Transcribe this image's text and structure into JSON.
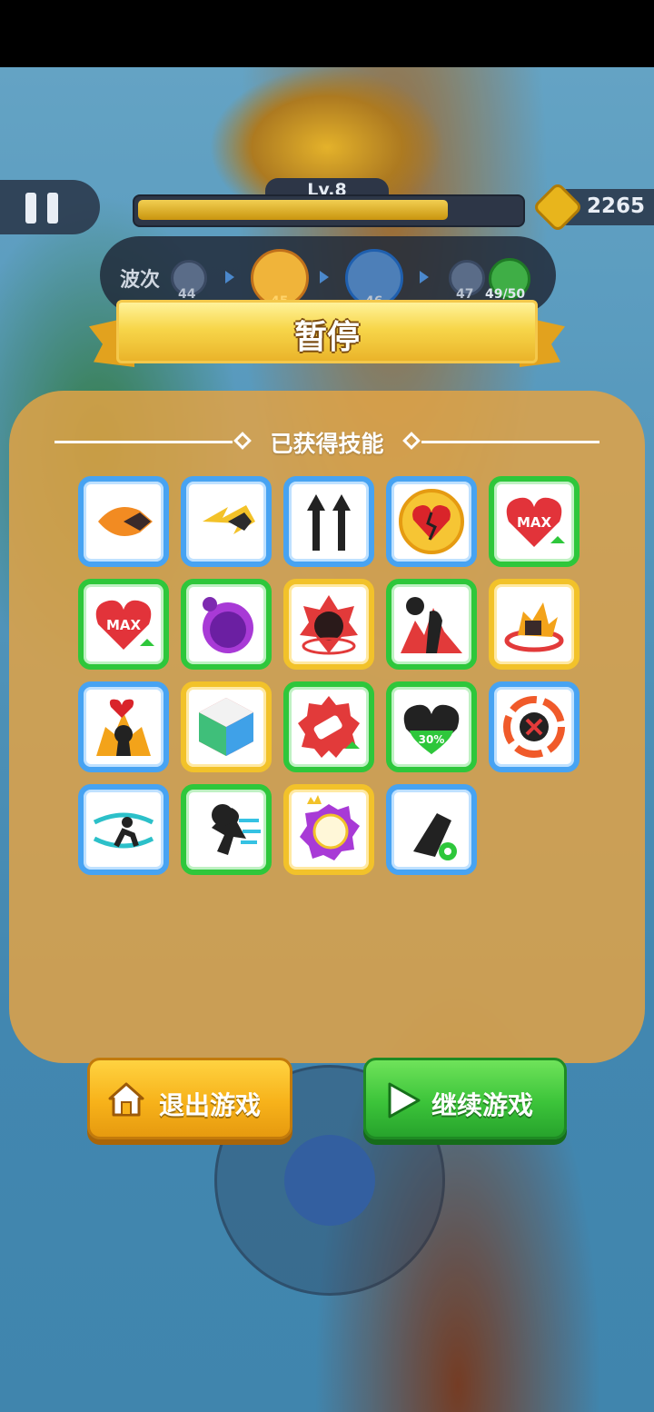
{
  "hud": {
    "level_label": "Lv.8",
    "xp_progress": 0.82,
    "coins": "2265",
    "wave": {
      "label": "波次",
      "nodes": [
        "44",
        "45",
        "46",
        "47",
        "49/50"
      ]
    }
  },
  "dialog": {
    "title": "暂停",
    "section_title": "已获得技能",
    "skills": [
      {
        "icon": "fire-arrowhead-icon",
        "rarity": "blue"
      },
      {
        "icon": "lightning-arrowhead-icon",
        "rarity": "blue"
      },
      {
        "icon": "double-arrow-icon",
        "rarity": "blue"
      },
      {
        "icon": "broken-heart-shield-icon",
        "rarity": "blue"
      },
      {
        "icon": "max-heart-icon",
        "rarity": "green",
        "text": "MAX"
      },
      {
        "icon": "max-heart-icon",
        "rarity": "green",
        "text": "MAX"
      },
      {
        "icon": "poison-blob-icon",
        "rarity": "green"
      },
      {
        "icon": "demon-rage-icon",
        "rarity": "yellow"
      },
      {
        "icon": "reaper-icon",
        "rarity": "green"
      },
      {
        "icon": "explosion-ring-icon",
        "rarity": "yellow"
      },
      {
        "icon": "heart-burst-icon",
        "rarity": "blue"
      },
      {
        "icon": "hex-cube-icon",
        "rarity": "yellow"
      },
      {
        "icon": "bullet-badge-icon",
        "rarity": "green"
      },
      {
        "icon": "heal-heart-icon",
        "rarity": "green",
        "text": "30%"
      },
      {
        "icon": "crit-target-icon",
        "rarity": "blue"
      },
      {
        "icon": "wind-dash-icon",
        "rarity": "blue"
      },
      {
        "icon": "speed-run-icon",
        "rarity": "green"
      },
      {
        "icon": "crown-orb-icon",
        "rarity": "yellow"
      },
      {
        "icon": "cannon-icon",
        "rarity": "blue"
      }
    ],
    "buttons": {
      "exit_label": "退出游戏",
      "continue_label": "继续游戏"
    }
  },
  "colors": {
    "blue_rarity": "#47a3f2",
    "green_rarity": "#2ec73b",
    "yellow_rarity": "#f2c22a",
    "exit_button": "#f7b21a",
    "continue_button": "#3cc43a"
  }
}
